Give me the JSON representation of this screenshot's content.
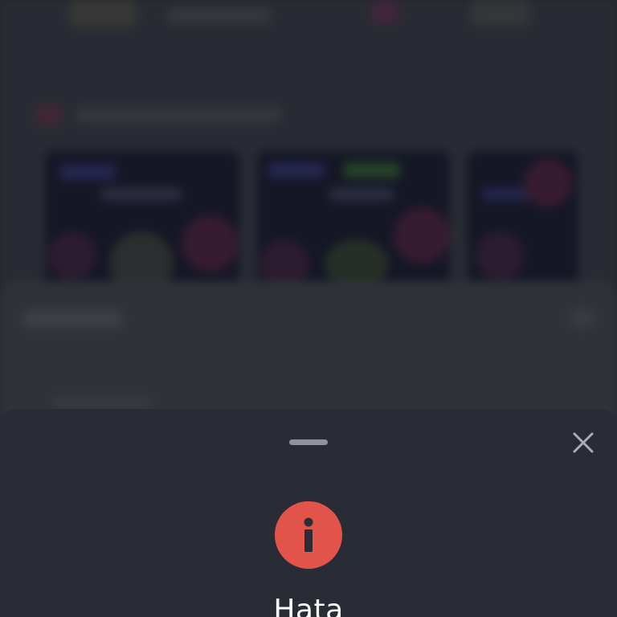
{
  "error_dialog": {
    "title": "Hata",
    "icon": "info-icon",
    "close_icon": "close-icon",
    "colors": {
      "sheet_background": "#292b35",
      "icon_background": "#e2544a",
      "handle": "#8f939d",
      "title_text": "#ffffff"
    }
  }
}
